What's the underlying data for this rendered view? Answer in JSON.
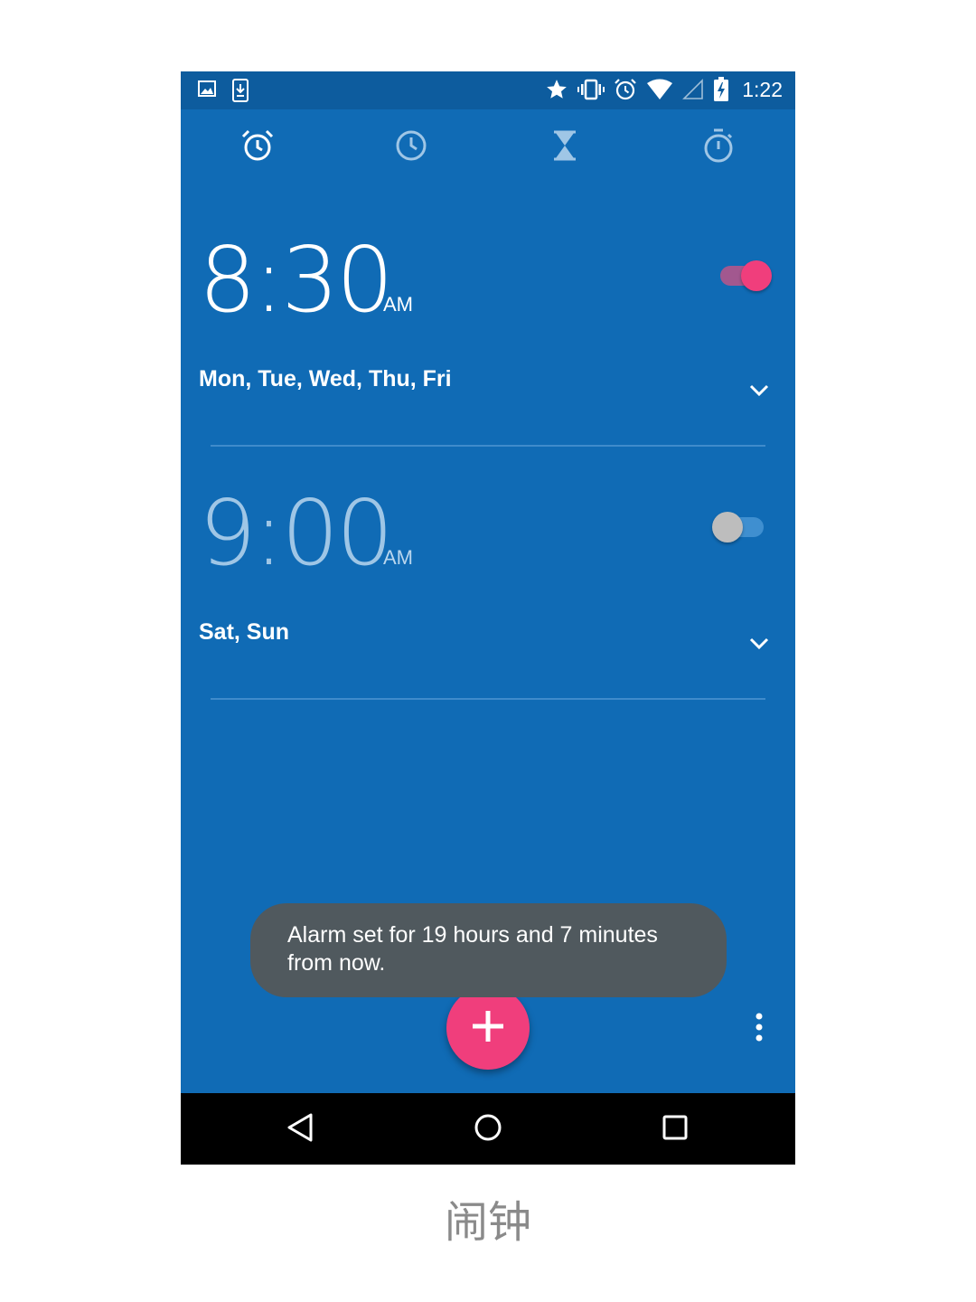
{
  "status_bar": {
    "time": "1:22",
    "left_icons": [
      "image-icon",
      "download-icon"
    ],
    "right_icons": [
      "star-icon",
      "vibrate-icon",
      "alarm-status-icon",
      "wifi-icon",
      "cell-signal-icon",
      "battery-charging-icon"
    ]
  },
  "tabs": [
    {
      "name": "alarm-icon",
      "active": true
    },
    {
      "name": "clock-icon",
      "active": false
    },
    {
      "name": "timer-icon",
      "active": false
    },
    {
      "name": "stopwatch-icon",
      "active": false
    }
  ],
  "alarms": [
    {
      "time": "8:30",
      "ampm": "AM",
      "days": "Mon, Tue, Wed, Thu, Fri",
      "enabled": true
    },
    {
      "time": "9:00",
      "ampm": "AM",
      "days": "Sat, Sun",
      "enabled": false
    }
  ],
  "toast": {
    "message": "Alarm set for 19 hours and 7 minutes from now."
  },
  "caption": "闹钟",
  "colors": {
    "background": "#106bb5",
    "status_bar": "#0d5c9e",
    "accent": "#f03e7c",
    "toast": "#50595e"
  }
}
